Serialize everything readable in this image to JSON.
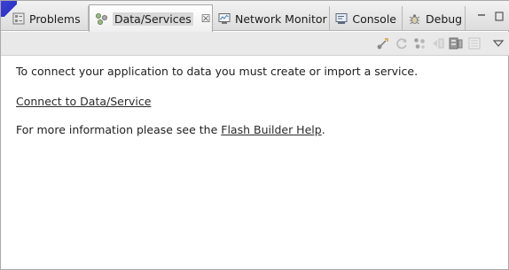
{
  "tabs": [
    {
      "label": "Problems",
      "icon": "problems-icon",
      "active": false
    },
    {
      "label": "Data/Services",
      "icon": "data-services-icon",
      "active": true,
      "close": "☒"
    },
    {
      "label": "Network Monitor",
      "icon": "network-monitor-icon",
      "active": false
    },
    {
      "label": "Console",
      "icon": "console-icon",
      "active": false
    },
    {
      "label": "Debug",
      "icon": "debug-icon",
      "active": false
    }
  ],
  "window_controls": {
    "minimize": "—",
    "maximize": "▭"
  },
  "toolbar": {
    "icons": [
      "connect-icon",
      "refresh-icon",
      "configure-icon",
      "generate-icon",
      "service-icon",
      "properties-icon",
      "view-menu-icon"
    ]
  },
  "content": {
    "intro": "To connect your application to data you must create or import a service.",
    "connect_link": "Connect to Data/Service",
    "more_info_prefix": "For more information please see the ",
    "help_link": "Flash Builder Help",
    "more_info_suffix": "."
  },
  "colors": {
    "accent": "#2f36c8",
    "tab_bg": "#dcdcdc",
    "content_bg": "#ffffff"
  }
}
